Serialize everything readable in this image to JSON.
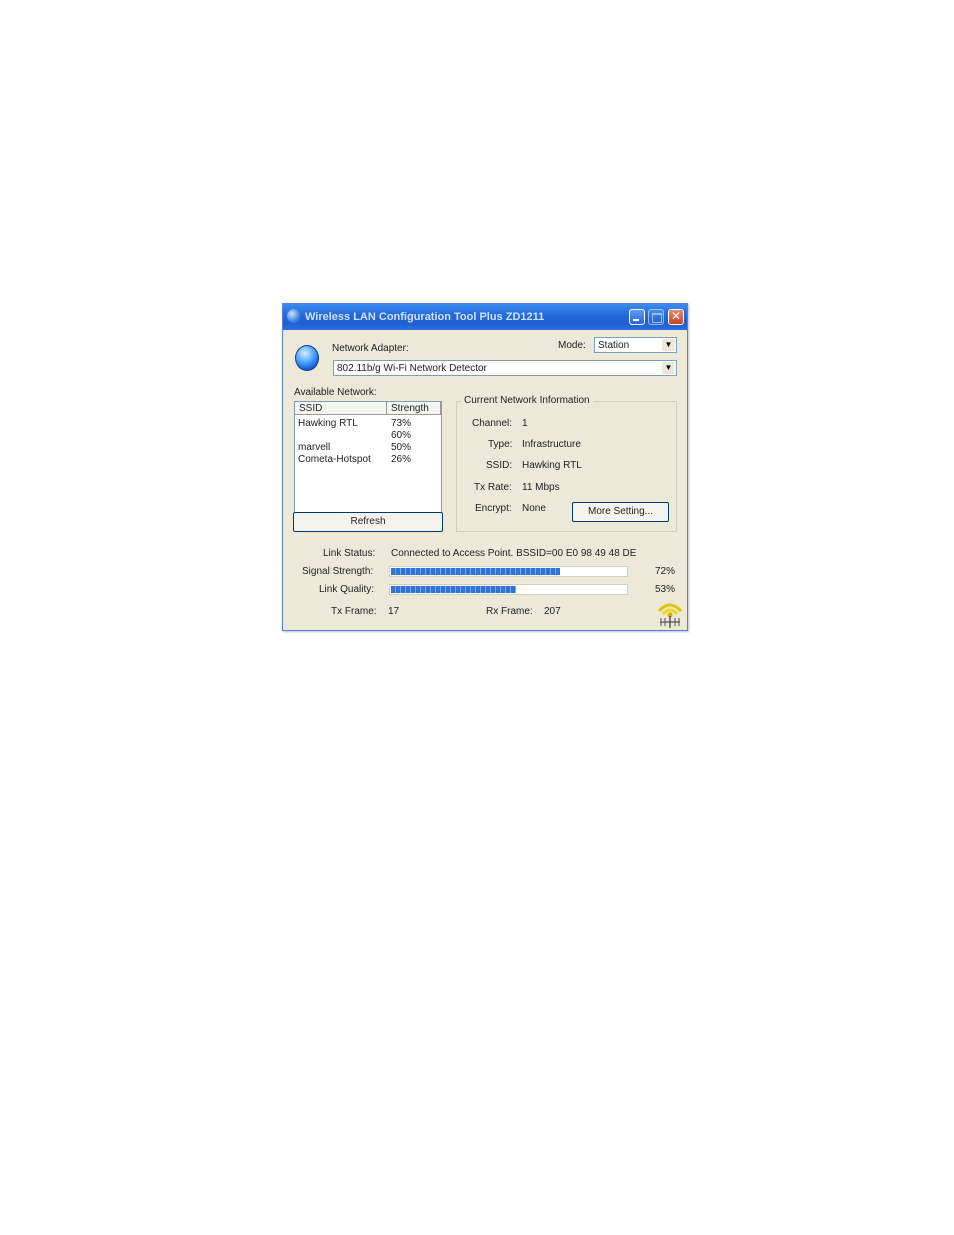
{
  "window": {
    "title": "Wireless LAN Configuration Tool Plus   ZD1211",
    "close_glyph": "✕"
  },
  "adapter": {
    "label": "Network Adapter:",
    "value": "802.11b/g Wi-Fi Network Detector"
  },
  "mode": {
    "label": "Mode:",
    "value": "Station"
  },
  "available": {
    "label": "Available Network:",
    "columns": [
      "SSID",
      "Strength"
    ],
    "rows": [
      {
        "ssid": "Hawking RTL",
        "strength": "73%"
      },
      {
        "ssid": "",
        "strength": "60%"
      },
      {
        "ssid": "marvell",
        "strength": "50%"
      },
      {
        "ssid": "Cometa-Hotspot",
        "strength": "26%"
      }
    ],
    "refresh_label": "Refresh"
  },
  "current": {
    "group_label": "Current Network Information",
    "channel_label": "Channel:",
    "channel_value": "1",
    "type_label": "Type:",
    "type_value": "Infrastructure",
    "ssid_label": "SSID:",
    "ssid_value": "Hawking RTL",
    "txrate_label": "Tx Rate:",
    "txrate_value": "11 Mbps",
    "encrypt_label": "Encrypt:",
    "encrypt_value": "None",
    "more_label": "More Setting..."
  },
  "status": {
    "link_label": "Link Status:",
    "link_value": "Connected to Access Point. BSSID=00 E0 98 49 48 DE",
    "signal_label": "Signal Strength:",
    "signal_percent": 72,
    "signal_text": "72%",
    "quality_label": "Link Quality:",
    "quality_percent": 53,
    "quality_text": "53%",
    "tx_label": "Tx Frame:",
    "tx_value": "17",
    "rx_label": "Rx Frame:",
    "rx_value": "207"
  },
  "colors": {
    "titlebar": "#2368d8",
    "bar_fill": "#2f73d9",
    "window_bg": "#ece9d8"
  }
}
